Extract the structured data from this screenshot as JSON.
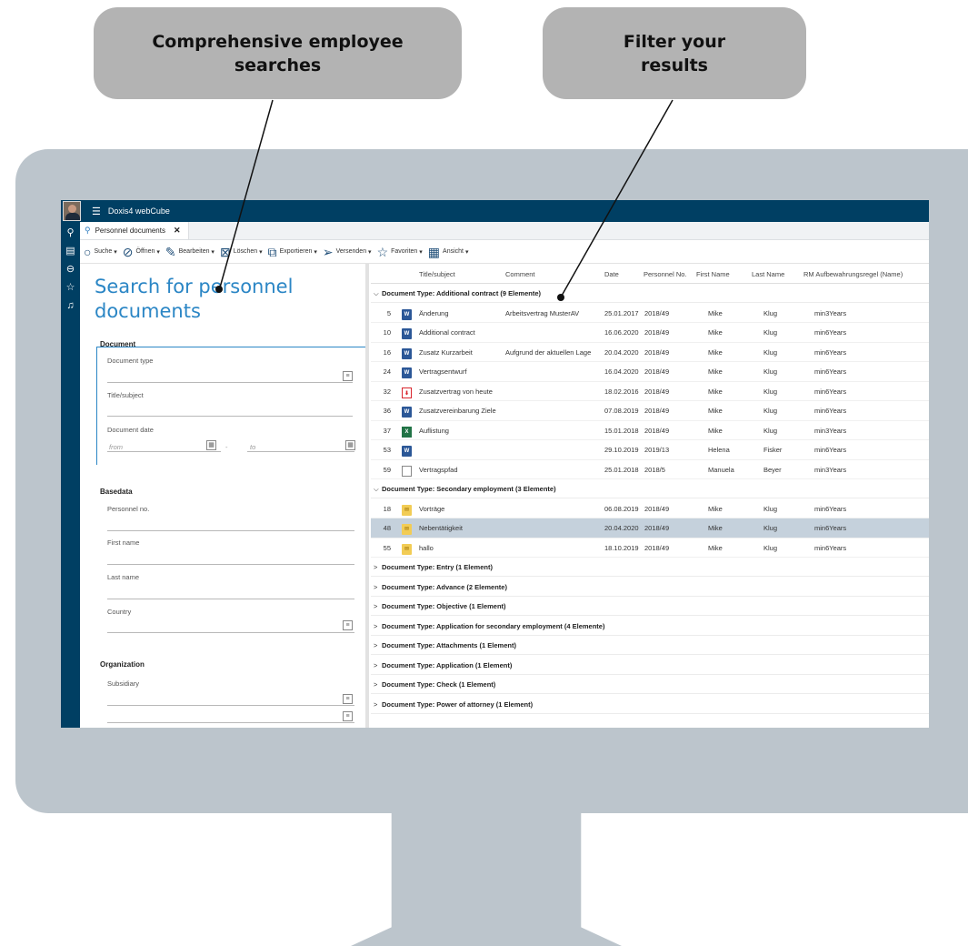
{
  "callouts": {
    "left": "Comprehensive employee searches",
    "right": "Filter your results"
  },
  "app": {
    "title": "Doxis4 webCube",
    "menu_icon": "hamburger-menu-icon"
  },
  "leftnav": [
    "search-icon",
    "clipboard-icon",
    "inbox-icon",
    "star-icon",
    "bell-icon"
  ],
  "tab": {
    "label": "Personnel documents",
    "close": "✕"
  },
  "toolbar": {
    "search": "Suche",
    "open": "Öffnen",
    "edit": "Bearbeiten",
    "delete": "Löschen",
    "export": "Exportieren",
    "send": "Versenden",
    "favorites": "Favoriten",
    "view": "Ansicht"
  },
  "search": {
    "title": "Search for personnel documents",
    "document_section": "Document",
    "document_type": "Document type",
    "title_subject": "Title/subject",
    "document_date": "Document date",
    "from_placeholder": "from",
    "to_placeholder": "to",
    "date_sep": "-",
    "basedata_section": "Basedata",
    "personnel_no": "Personnel no.",
    "first_name": "First name",
    "last_name": "Last name",
    "country": "Country",
    "organization_section": "Organization",
    "subsidiary": "Subsidiary"
  },
  "results": {
    "columns": [
      "Title/subject",
      "Comment",
      "Date",
      "Personnel No.",
      "First Name",
      "Last Name",
      "RM Aufbewahrungsregel (Name)"
    ],
    "groups": [
      {
        "label": "Document Type: Additional contract (9 Elemente)",
        "expanded": true,
        "rows": [
          {
            "num": "5",
            "icon": "word",
            "title": "Änderung",
            "comment": "Arbeitsvertrag MusterAV",
            "date": "25.01.2017",
            "pno": "2018/49",
            "first": "Mike",
            "last": "Klug",
            "rm": "min3Years"
          },
          {
            "num": "10",
            "icon": "word",
            "title": "Additional contract",
            "comment": "",
            "date": "16.06.2020",
            "pno": "2018/49",
            "first": "Mike",
            "last": "Klug",
            "rm": "min6Years"
          },
          {
            "num": "16",
            "icon": "word",
            "title": "Zusatz Kurzarbeit",
            "comment": "Aufgrund der aktuellen Lage",
            "date": "20.04.2020",
            "pno": "2018/49",
            "first": "Mike",
            "last": "Klug",
            "rm": "min6Years"
          },
          {
            "num": "24",
            "icon": "word",
            "title": "Vertragsentwurf",
            "comment": "",
            "date": "16.04.2020",
            "pno": "2018/49",
            "first": "Mike",
            "last": "Klug",
            "rm": "min6Years"
          },
          {
            "num": "32",
            "icon": "pdf",
            "title": "Zusatzvertrag von heute",
            "comment": "",
            "date": "18.02.2016",
            "pno": "2018/49",
            "first": "Mike",
            "last": "Klug",
            "rm": "min6Years"
          },
          {
            "num": "36",
            "icon": "word",
            "title": "Zusatzvereinbarung Ziele",
            "comment": "",
            "date": "07.08.2019",
            "pno": "2018/49",
            "first": "Mike",
            "last": "Klug",
            "rm": "min6Years"
          },
          {
            "num": "37",
            "icon": "excel",
            "title": "Auflistung",
            "comment": "",
            "date": "15.01.2018",
            "pno": "2018/49",
            "first": "Mike",
            "last": "Klug",
            "rm": "min3Years"
          },
          {
            "num": "53",
            "icon": "word",
            "title": "",
            "comment": "",
            "date": "29.10.2019",
            "pno": "2019/13",
            "first": "Helena",
            "last": "Fisker",
            "rm": "min6Years"
          },
          {
            "num": "59",
            "icon": "file",
            "title": "Vertragspfad",
            "comment": "",
            "date": "25.01.2018",
            "pno": "2018/5",
            "first": "Manuela",
            "last": "Beyer",
            "rm": "min3Years"
          }
        ]
      },
      {
        "label": "Document Type: Secondary employment (3 Elemente)",
        "expanded": true,
        "rows": [
          {
            "num": "18",
            "icon": "mail",
            "title": "Vorträge",
            "comment": "",
            "date": "06.08.2019",
            "pno": "2018/49",
            "first": "Mike",
            "last": "Klug",
            "rm": "min6Years"
          },
          {
            "num": "48",
            "icon": "mail",
            "title": "Nebentätigkeit",
            "comment": "",
            "date": "20.04.2020",
            "pno": "2018/49",
            "first": "Mike",
            "last": "Klug",
            "rm": "min6Years",
            "selected": true
          },
          {
            "num": "55",
            "icon": "mail",
            "title": "hallo",
            "comment": "",
            "date": "18.10.2019",
            "pno": "2018/49",
            "first": "Mike",
            "last": "Klug",
            "rm": "min6Years"
          }
        ]
      },
      {
        "label": "Document Type: Entry (1 Element)",
        "expanded": false,
        "rows": []
      },
      {
        "label": "Document Type: Advance (2 Elemente)",
        "expanded": false,
        "rows": []
      },
      {
        "label": "Document Type: Objective (1 Element)",
        "expanded": false,
        "rows": []
      },
      {
        "label": "Document Type: Application for secondary employment (4 Elemente)",
        "expanded": false,
        "rows": []
      },
      {
        "label": "Document Type: Attachments (1 Element)",
        "expanded": false,
        "rows": []
      },
      {
        "label": "Document Type: Application (1 Element)",
        "expanded": false,
        "rows": []
      },
      {
        "label": "Document Type: Check (1 Element)",
        "expanded": false,
        "rows": []
      },
      {
        "label": "Document Type: Power of attorney (1 Element)",
        "expanded": false,
        "rows": []
      }
    ]
  }
}
